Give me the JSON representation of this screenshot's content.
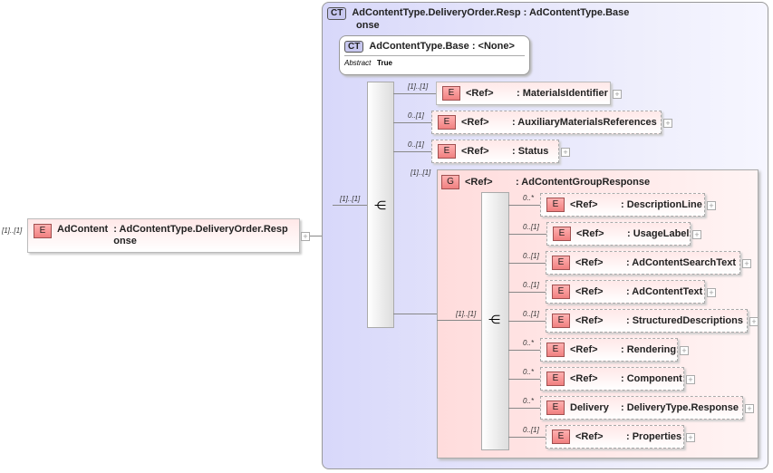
{
  "root": {
    "multiplicity": "[1]..[1]",
    "badge": "E",
    "name": "AdContent",
    "type": ": AdContentType.DeliveryOrder.Resp",
    "type_wrap": "onse"
  },
  "complex_type": {
    "badge": "CT",
    "name": "AdContentType.DeliveryOrder.Resp",
    "base": ": AdContentType.Base",
    "name_wrap": "onse"
  },
  "base_type": {
    "badge": "CT",
    "name": "AdContentType.Base",
    "base": ": <None>",
    "attr_label": "Abstract",
    "attr_value": "True"
  },
  "sequence_multiplicity": "[1]..[1]",
  "elements": [
    {
      "mult": "[1]..[1]",
      "badge": "E",
      "name": "<Ref>",
      "type": ": MaterialsIdentifier",
      "optional": false
    },
    {
      "mult": "0..[1]",
      "badge": "E",
      "name": "<Ref>",
      "type": ": AuxiliaryMaterialsReferences",
      "optional": true
    },
    {
      "mult": "0..[1]",
      "badge": "E",
      "name": "<Ref>",
      "type": ": Status",
      "optional": true
    }
  ],
  "group": {
    "mult": "[1]..[1]",
    "badge": "G",
    "name": "<Ref>",
    "type": ": AdContentGroupResponse",
    "sequence_multiplicity": "[1]..[1]",
    "children": [
      {
        "mult": "0..*",
        "badge": "E",
        "name": "<Ref>",
        "type": ": DescriptionLine"
      },
      {
        "mult": "0..[1]",
        "badge": "E",
        "name": "<Ref>",
        "type": ": UsageLabel"
      },
      {
        "mult": "0..[1]",
        "badge": "E",
        "name": "<Ref>",
        "type": ": AdContentSearchText"
      },
      {
        "mult": "0..[1]",
        "badge": "E",
        "name": "<Ref>",
        "type": ": AdContentText"
      },
      {
        "mult": "0..[1]",
        "badge": "E",
        "name": "<Ref>",
        "type": ": StructuredDescriptions"
      },
      {
        "mult": "0..*",
        "badge": "E",
        "name": "<Ref>",
        "type": ": Rendering"
      },
      {
        "mult": "0..*",
        "badge": "E",
        "name": "<Ref>",
        "type": ": Component"
      },
      {
        "mult": "0..*",
        "badge": "E",
        "name": "Delivery",
        "type": ": DeliveryType.Response"
      },
      {
        "mult": "0..[1]",
        "badge": "E",
        "name": "<Ref>",
        "type": ": Properties"
      }
    ]
  }
}
